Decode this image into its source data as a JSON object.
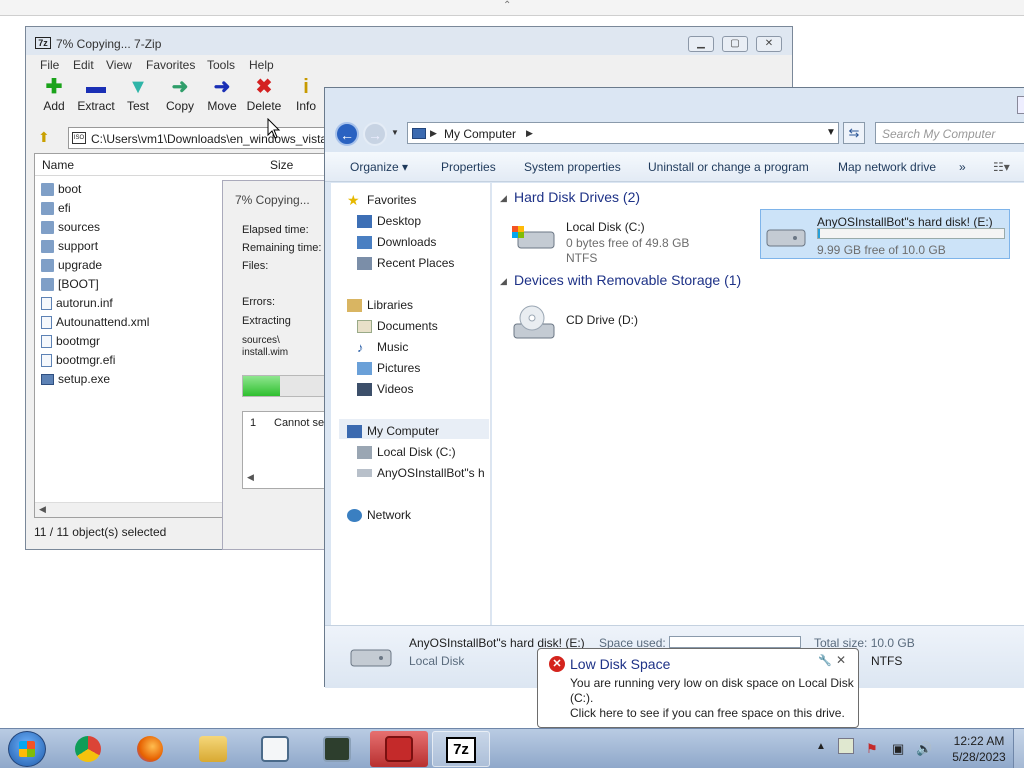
{
  "sevenzip": {
    "title": "7% Copying... 7-Zip",
    "menu": [
      "File",
      "Edit",
      "View",
      "Favorites",
      "Tools",
      "Help"
    ],
    "toolbar": [
      {
        "label": "Add",
        "icon": "plus-icon",
        "color": "#1aa31a"
      },
      {
        "label": "Extract",
        "icon": "minus-icon",
        "color": "#1a2fb5"
      },
      {
        "label": "Test",
        "icon": "check-down-icon",
        "color": "#2fb5a8"
      },
      {
        "label": "Copy",
        "icon": "arrow-right-green-icon",
        "color": "#2f9e6a"
      },
      {
        "label": "Move",
        "icon": "arrow-right-blue-icon",
        "color": "#1a2fb5"
      },
      {
        "label": "Delete",
        "icon": "x-icon",
        "color": "#d42020"
      },
      {
        "label": "Info",
        "icon": "info-icon",
        "color": "#c79a00"
      }
    ],
    "address": "C:\\Users\\vm1\\Downloads\\en_windows_vista",
    "columns": {
      "name": "Name",
      "size": "Size"
    },
    "files": [
      {
        "name": "boot",
        "type": "folder"
      },
      {
        "name": "efi",
        "type": "folder"
      },
      {
        "name": "sources",
        "type": "folder"
      },
      {
        "name": "support",
        "type": "folder"
      },
      {
        "name": "upgrade",
        "type": "folder"
      },
      {
        "name": "[BOOT]",
        "type": "folder"
      },
      {
        "name": "autorun.inf",
        "type": "file"
      },
      {
        "name": "Autounattend.xml",
        "type": "file"
      },
      {
        "name": "bootmgr",
        "type": "file"
      },
      {
        "name": "bootmgr.efi",
        "type": "file"
      },
      {
        "name": "setup.exe",
        "type": "exe"
      }
    ],
    "status": "11 / 11 object(s) selected"
  },
  "copy_dialog": {
    "title": "7% Copying...",
    "elapsed_label": "Elapsed time:",
    "remaining_label": "Remaining time:",
    "files_label": "Files:",
    "errors_label": "Errors:",
    "extracting_label": "Extracting",
    "path_line1": "sources\\",
    "path_line2": "install.wim",
    "progress_fraction": 0.4,
    "log_index": "1",
    "log_text": "Cannot set"
  },
  "explorer": {
    "breadcrumb": "My Computer",
    "search_placeholder": "Search My Computer",
    "commands": [
      "Organize ▾",
      "Properties",
      "System properties",
      "Uninstall or change a program",
      "Map network drive",
      "»"
    ],
    "nav": {
      "favorites": "Favorites",
      "desktop": "Desktop",
      "downloads": "Downloads",
      "recent": "Recent Places",
      "libraries": "Libraries",
      "documents": "Documents",
      "music": "Music",
      "pictures": "Pictures",
      "videos": "Videos",
      "computer": "My Computer",
      "local_disk": "Local Disk (C:)",
      "usb_disk": "AnyOSInstallBot\"s h",
      "network": "Network"
    },
    "groups": {
      "hdd": "Hard Disk Drives (2)",
      "removable": "Devices with Removable Storage (1)"
    },
    "drives": {
      "c": {
        "name": "Local Disk (C:)",
        "free": "0 bytes free of 49.8 GB",
        "fs": "NTFS"
      },
      "e": {
        "name": "AnyOSInstallBot\"s hard disk! (E:)",
        "free": "9.99 GB free of 10.0 GB",
        "used_fraction": 0.01
      },
      "d": {
        "name": "CD Drive (D:)"
      }
    },
    "details": {
      "name": "AnyOSInstallBot\"s hard disk! (E:)",
      "type": "Local Disk",
      "space_used_label": "Space used:",
      "total_size": "Total size: 10.0 GB",
      "fs": "NTFS"
    }
  },
  "notification": {
    "title": "Low Disk Space",
    "message": "You are running very low on disk space on Local Disk (C:).",
    "link": "Click here to see if you can free space on this drive."
  },
  "taskbar": {
    "time": "12:22 AM",
    "date": "5/28/2023",
    "zip_label": "7z"
  }
}
